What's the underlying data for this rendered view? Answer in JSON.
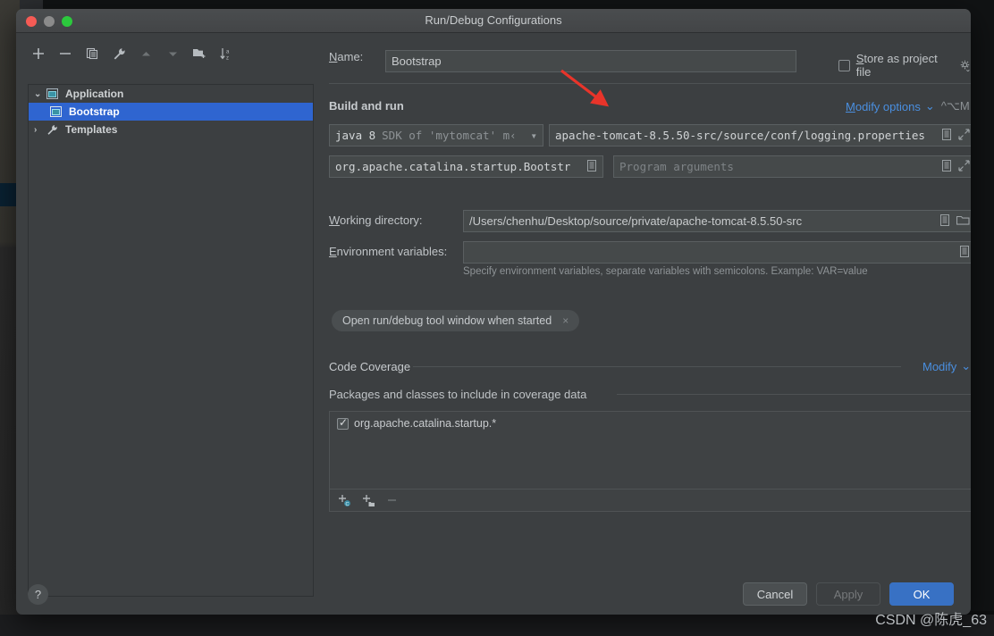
{
  "window": {
    "title": "Run/Debug Configurations",
    "traffic_lights": [
      "close-button",
      "minimize-button",
      "zoom-button"
    ]
  },
  "tree_toolbar": [
    {
      "name": "add-configuration-button",
      "glyph": "+",
      "enabled": true
    },
    {
      "name": "remove-configuration-button",
      "glyph": "−",
      "enabled": true
    },
    {
      "name": "copy-configuration-button",
      "glyph": "⎘",
      "enabled": true
    },
    {
      "name": "edit-templates-button",
      "glyph": "🔧",
      "enabled": true
    },
    {
      "name": "move-up-button",
      "glyph": "▲",
      "enabled": false
    },
    {
      "name": "move-down-button",
      "glyph": "▼",
      "enabled": false
    },
    {
      "name": "move-into-folder-button",
      "glyph": "⬒",
      "enabled": true
    },
    {
      "name": "sort-configurations-button",
      "glyph": "↓",
      "enabled": true
    }
  ],
  "tree": {
    "items": [
      {
        "label": "Application",
        "level": 0,
        "twisty": "⌄",
        "icon": "application-icon",
        "selected": false
      },
      {
        "label": "Bootstrap",
        "level": 1,
        "twisty": "",
        "icon": "application-icon",
        "selected": true
      },
      {
        "label": "Templates",
        "level": 0,
        "twisty": "›",
        "icon": "wrench-icon",
        "selected": false
      }
    ]
  },
  "form": {
    "name_label": "Name:",
    "name_value": "Bootstrap",
    "store_as_project_file_label": "Store as project file",
    "store_as_project_file_checked": false,
    "build_and_run_title": "Build and run",
    "modify_options_label": "Modify options",
    "modify_options_shortcut": "^⌥M",
    "jre_value": "java 8",
    "jre_suffix": "SDK of 'mytomcat' m‹",
    "vm_options_value": "apache-tomcat-8.5.50-src/source/conf/logging.properties",
    "main_class_value": "org.apache.catalina.startup.Bootstr",
    "program_arguments_placeholder": "Program arguments",
    "working_directory_label": "Working directory:",
    "working_directory_value": "/Users/chenhu/Desktop/source/private/apache-tomcat-8.5.50-src",
    "environment_variables_label": "Environment variables:",
    "environment_variables_value": "",
    "environment_variables_hint": "Specify environment variables, separate variables with semicolons. Example: VAR=value",
    "tool_window_chip_label": "Open run/debug tool window when started",
    "tool_window_chip_close": "×"
  },
  "coverage": {
    "section_title": "Code Coverage",
    "modify_label": "Modify",
    "subtitle": "Packages and classes to include in coverage data",
    "items": [
      {
        "label": "org.apache.catalina.startup.*",
        "checked": true
      }
    ],
    "toolbar": [
      {
        "name": "add-class-button",
        "enabled": true
      },
      {
        "name": "add-package-button",
        "enabled": true
      },
      {
        "name": "remove-pattern-button",
        "enabled": false
      }
    ]
  },
  "footer": {
    "help_label": "?",
    "cancel_label": "Cancel",
    "apply_label": "Apply",
    "apply_enabled": false,
    "ok_label": "OK"
  },
  "watermark": "CSDN @陈虎_63",
  "colors": {
    "dialog_background": "#3c3f41",
    "selection_blue": "#2f65d0",
    "link_blue": "#4a8fe0",
    "primary_button": "#3871c4",
    "annotation_red": "#e8342a"
  }
}
